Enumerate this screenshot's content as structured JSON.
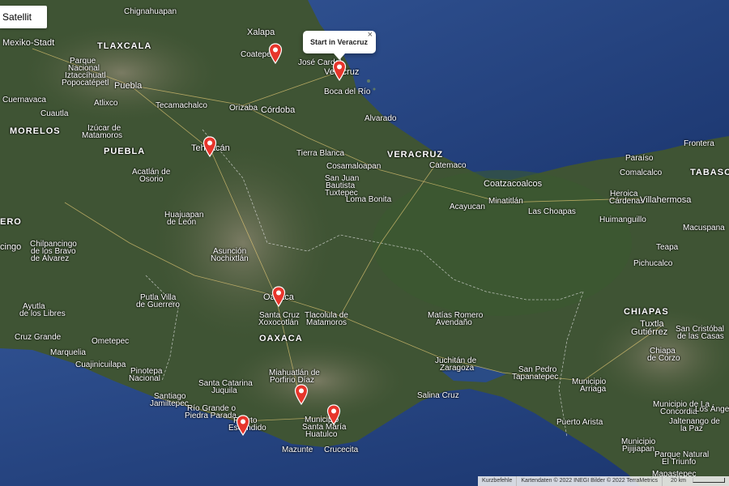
{
  "map_type_button": "Satellit",
  "info_window": {
    "title": "Start in Veracruz",
    "close_glyph": "×"
  },
  "states": {
    "tlaxcala": "TLAXCALA",
    "morelos": "MORELOS",
    "puebla": "PUEBLA",
    "veracruz": "VERACRUZ",
    "oaxaca": "OAXACA",
    "chiapas": "CHIAPAS",
    "tabasco": "TABASCO",
    "guerrero_partial": "ERO"
  },
  "places": {
    "chignahuapan": "Chignahuapan",
    "xalapa": "Xalapa",
    "coatepec": "Coatepec",
    "jose_cardel": "José Cardel",
    "veracruz": "Veracruz",
    "boca_del_rio": "Boca del Río",
    "mexiko_stadt": "Mexiko-Stadt",
    "parque": "Parque",
    "nacional": "Nacional",
    "iztaccihuatl": "Iztaccíhuatl",
    "popocatepetl": "Popocatépetl",
    "puebla": "Puebla",
    "cuernavaca": "Cuernavaca",
    "cuautla": "Cuautla",
    "atlixco": "Atlixco",
    "tecamachalco": "Tecamachalco",
    "orizaba": "Orizaba",
    "cordoba": "Córdoba",
    "alvarado": "Alvarado",
    "izucar_1": "Izúcar de",
    "izucar_2": "Matamoros",
    "tehuacan": "Tehuacán",
    "tierra_blanca": "Tierra Blanca",
    "catemaco": "Catemaco",
    "frontera": "Frontera",
    "paraiso": "Paraíso",
    "comalcalco": "Comalcalco",
    "cosamaloapan": "Cosamaloapan",
    "san_juan_1": "San Juan",
    "san_juan_2": "Bautista",
    "san_juan_3": "Tuxtepec",
    "coatzacoalcos": "Coatzacoalcos",
    "minatitlan": "Minatitlán",
    "heroica": "Heroica",
    "cardenas": "Cárdenas",
    "villahermosa": "Villahermosa",
    "loma_bonita": "Loma Bonita",
    "acayucan": "Acayucan",
    "las_choapas": "Las Choapas",
    "huimanguillo": "Huimanguillo",
    "macuspana": "Macuspana",
    "acatlan_1": "Acatlán de",
    "acatlan_2": "Osorio",
    "huajuapan_1": "Huajuapan",
    "huajuapan_2": "de León",
    "cingo": "cingo",
    "chilpancingo_1": "Chilpancingo",
    "chilpancingo_2": "de los Bravo",
    "chilpancingo_3": "de Álvarez",
    "asuncion_1": "Asunción",
    "asuncion_2": "Nochixtlán",
    "teapa": "Teapa",
    "pichucalco": "Pichucalco",
    "oaxaca": "Oaxaca",
    "santa_cruz_1": "Santa Cruz",
    "santa_cruz_2": "Xoxocotlán",
    "tlacolula_1": "Tlacolula de",
    "tlacolula_2": "Matamoros",
    "putla_1": "Putla Villa",
    "putla_2": "de Guerrero",
    "ayutla_1": "Ayutla",
    "ayutla_2": "de los Libres",
    "matias_1": "Matías Romero",
    "matias_2": "Avendaño",
    "tuxtla_1": "Tuxtla",
    "tuxtla_2": "Gutiérrez",
    "san_cristobal_1": "San Cristóbal",
    "san_cristobal_2": "de las Casas",
    "cruz_grande": "Cruz Grande",
    "ometepec": "Ometepec",
    "marquelia": "Marquelia",
    "cuajinicuilapa": "Cuajinicuilapa",
    "pinotepa_1": "Pinotepa",
    "pinotepa_2": "Nacional",
    "miahuatlan_1": "Miahuatlán de",
    "miahuatlan_2": "Porfirio Díaz",
    "juchitan_1": "Juchitán de",
    "juchitan_2": "Zaragoza",
    "chiapa_1": "Chiapa",
    "chiapa_2": "de Corzo",
    "san_pedro_1": "San Pedro",
    "san_pedro_2": "Tapanatepec",
    "municipio_1": "Municipio",
    "municipio_2": "Arriaga",
    "santa_catarina_1": "Santa Catarina",
    "santa_catarina_2": "Juquila",
    "santiago_1": "Santiago",
    "santiago_2": "Jamiltepec",
    "rio_grande_1": "Río Grande o",
    "rio_grande_2": "Piedra Parada",
    "salina_cruz": "Salina Cruz",
    "concordia_1": "Municipio de La",
    "concordia_2": "Concordia",
    "jaltenango_1": "Jaltenango de",
    "jaltenango_2": "la Paz",
    "puerto_1": "Puerto",
    "puerto_2": "Escondido",
    "huatulco_1": "Municipio",
    "huatulco_2": "Santa María",
    "huatulco_3": "Huatulco",
    "puerto_arista": "Puerto Arista",
    "municipio_pijijiapan_1": "Municipio",
    "municipio_pijijiapan_2": "Pijijiapan",
    "el_triunfo_1": "Parque Natural",
    "el_triunfo_2": "El Triunfo",
    "mazunte": "Mazunte",
    "crucecita": "Crucecita",
    "mapastepec": "Mapastepec",
    "los_angeles": "Los Ángeles"
  },
  "footer": {
    "shortcuts": "Kurzbefehle",
    "attribution": "Kartendaten © 2022 INEGI Bilder © 2022 TerraMetrics",
    "scale": "20 km"
  },
  "colors": {
    "marker": "#e7352b",
    "ocean": "#1f3f7a",
    "land": "#3d5232"
  },
  "icons": {
    "marker": "map-pin-icon",
    "close": "close-icon"
  }
}
